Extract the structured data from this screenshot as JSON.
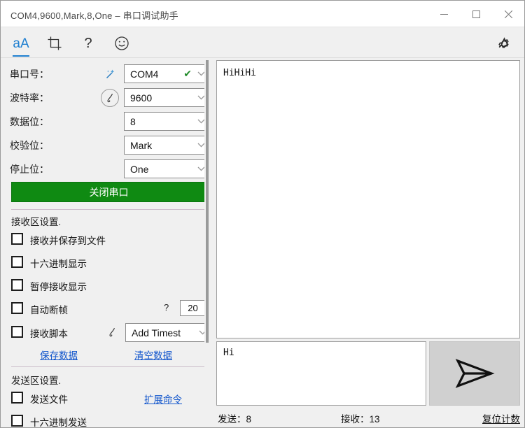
{
  "window": {
    "title": "COM4,9600,Mark,8,One – 串口调试助手",
    "minimize_label": "minimize",
    "maximize_label": "maximize",
    "close_label": "close"
  },
  "toolbar": {
    "font_icon": "aA",
    "font_icon_name": "font-size-icon",
    "crop_icon_name": "crop-icon",
    "help_icon": "?",
    "emoji_icon_name": "smiley-icon",
    "settings_icon_name": "gear-icon"
  },
  "config": {
    "rows": [
      {
        "label": "串口号：",
        "value": "COM4",
        "has_check": true,
        "icon": "magic-wand-icon"
      },
      {
        "label": "波特率：",
        "value": "9600",
        "has_check": false,
        "icon": "pen-circle-icon"
      },
      {
        "label": "数据位：",
        "value": "8",
        "has_check": false,
        "icon": ""
      },
      {
        "label": "校验位：",
        "value": "Mark",
        "has_check": false,
        "icon": ""
      },
      {
        "label": "停止位：",
        "value": "One",
        "has_check": false,
        "icon": ""
      }
    ],
    "toggle_port_button": "关闭串口",
    "toggle_port_color": "#0f8a12"
  },
  "receive_settings": {
    "title": "接收区设置.",
    "checkboxes": [
      {
        "label": "接收并保存到文件",
        "checked": false
      },
      {
        "label": "十六进制显示",
        "checked": false
      },
      {
        "label": "暂停接收显示",
        "checked": false
      },
      {
        "label": "自动断帧",
        "checked": false
      },
      {
        "label": "接收脚本",
        "checked": false
      }
    ],
    "auto_frame_hint": "?",
    "auto_frame_value": "20",
    "script_combo_value": "Add Timest",
    "script_icon": "pen-icon",
    "save_data_link": "保存数据",
    "clear_data_link": "清空数据"
  },
  "send_settings": {
    "title": "发送区设置.",
    "checkboxes": [
      {
        "label": "发送文件",
        "checked": false
      },
      {
        "label": "十六进制发送",
        "checked": false
      }
    ],
    "extended_cmd_link": "扩展命令"
  },
  "receive_area": {
    "text": "HiHiHi"
  },
  "send_area": {
    "text": "Hi",
    "send_icon": "paper-plane-icon"
  },
  "status": {
    "sent": "发送：8",
    "received": "接收：13",
    "reset_link": "复位计数"
  }
}
